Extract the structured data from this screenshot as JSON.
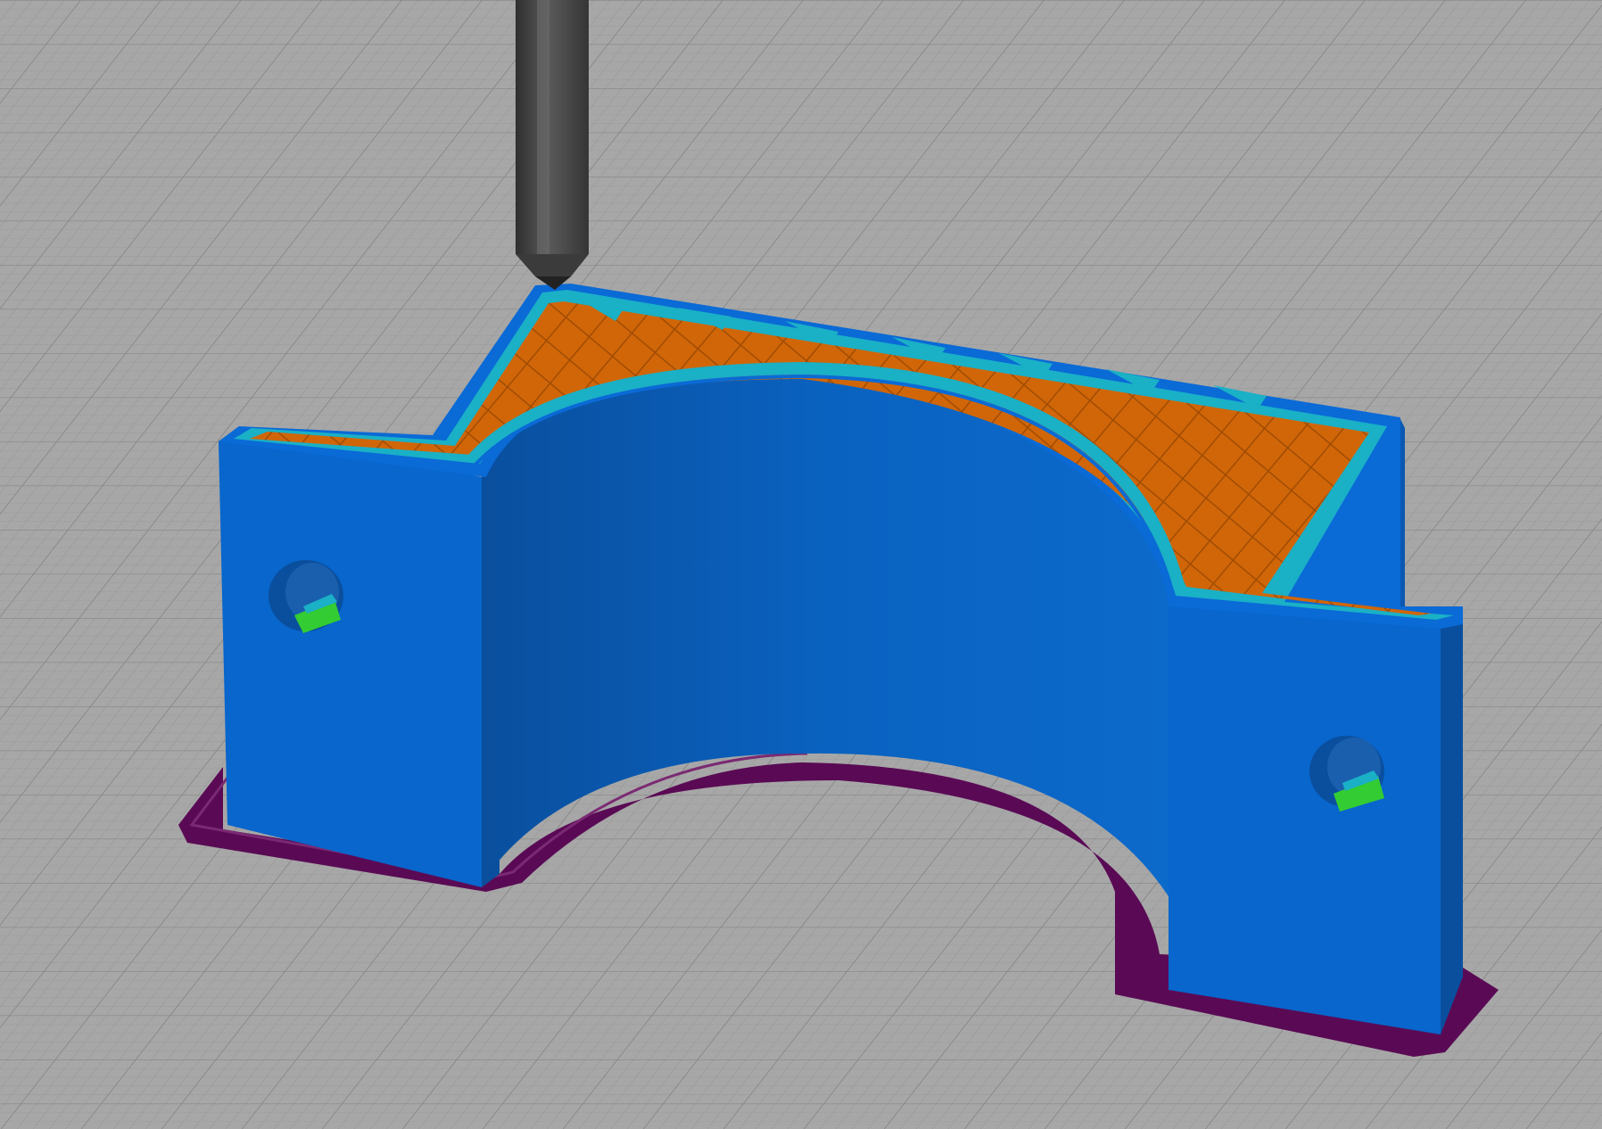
{
  "viewer": {
    "mode": "gcode-preview",
    "background_color": "#a7a7a7",
    "grid_color": "#8f8f8f"
  },
  "colors": {
    "external_perimeter": "#0066cc",
    "perimeter": "#1ab0c6",
    "infill": "#d86a0a",
    "skirt": "#5a0a55",
    "solid_infill": "#33cc33",
    "nozzle": "#4a4a4a"
  },
  "objects": [
    {
      "name": "part",
      "icon": "bracket-model-icon"
    },
    {
      "name": "nozzle",
      "icon": "nozzle-icon"
    }
  ]
}
